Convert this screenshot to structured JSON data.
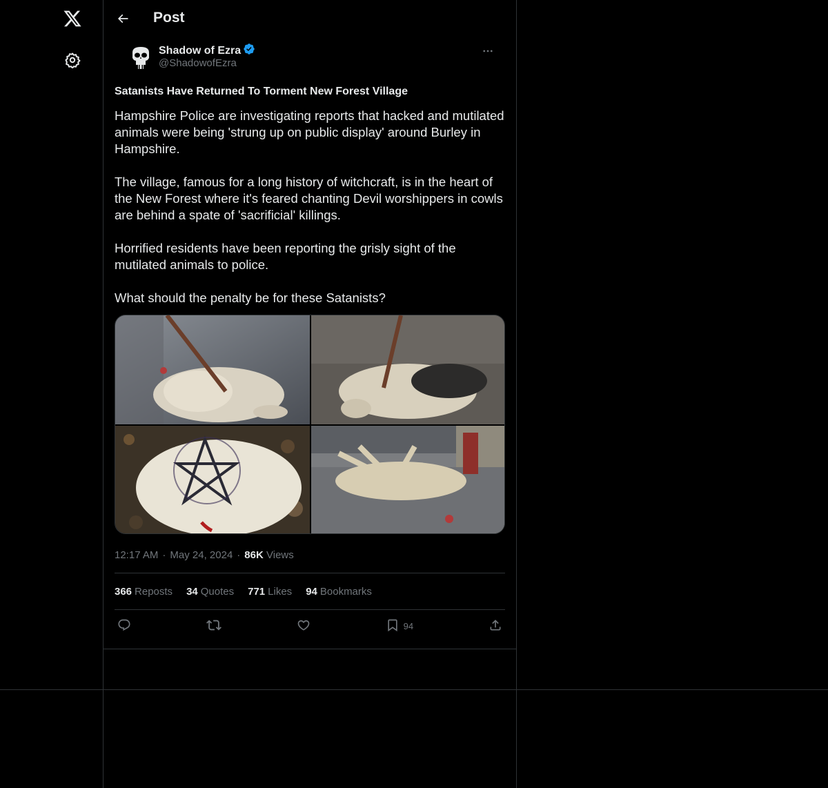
{
  "header": {
    "title": "Post"
  },
  "author": {
    "name": "Shadow of Ezra",
    "handle": "@ShadowofEzra",
    "verified_color": "#1d9bf0"
  },
  "post": {
    "headline": "Satanists Have Returned To Torment New Forest Village",
    "paragraphs": [
      "Hampshire Police are investigating reports that hacked and mutilated animals were being 'strung up on public display' around Burley in Hampshire.",
      "The village, famous for a long history of witchcraft, is in the heart of the New Forest where it's feared chanting Devil worshippers in cowls are behind a spate of 'sacrificial' killings.",
      "Horrified residents have been reporting the grisly sight of the mutilated animals to police.",
      "What should the penalty be for these Satanists?"
    ],
    "media_count": 4
  },
  "meta": {
    "time": "12:17 AM",
    "date": "May 24, 2024",
    "views_count": "86K",
    "views_label": "Views"
  },
  "stats": {
    "reposts_count": "366",
    "reposts_label": "Reposts",
    "quotes_count": "34",
    "quotes_label": "Quotes",
    "likes_count": "771",
    "likes_label": "Likes",
    "bookmarks_count": "94",
    "bookmarks_label": "Bookmarks"
  },
  "actions": {
    "bookmark_count": "94"
  },
  "icons": [
    "x-logo-icon",
    "settings-icon",
    "back-arrow-icon",
    "verified-badge-icon",
    "more-icon",
    "reply-icon",
    "repost-icon",
    "like-icon",
    "bookmark-icon",
    "share-icon"
  ]
}
